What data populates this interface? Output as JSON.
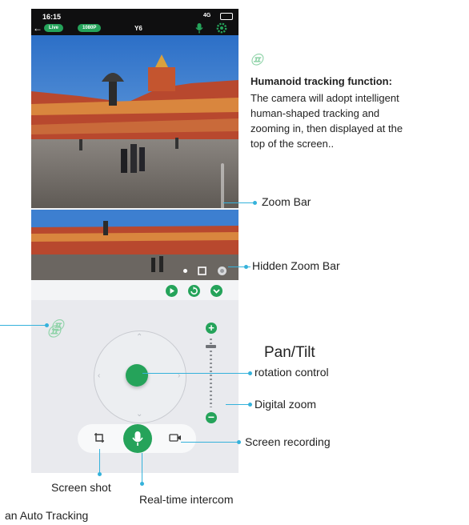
{
  "status_bar": {
    "time": "16:15",
    "signal": "4G"
  },
  "header": {
    "live_pill": "Live",
    "quality_pill": "1080P",
    "device_name": "Y6"
  },
  "control": {
    "track_icon_text": "㉬",
    "zoom_plus": "+",
    "zoom_minus": "−"
  },
  "annotations": {
    "humanoid_title": "Humanoid tracking function:",
    "humanoid_desc": "The camera will adopt intelligent\nhuman-shaped tracking and\nzooming in, then displayed at the\ntop of the screen..",
    "zoom_bar": "Zoom Bar",
    "hidden_zoom_bar": "Hidden Zoom Bar",
    "pan_tilt": "Pan/Tilt",
    "rotation_control": "rotation control",
    "digital_zoom": "Digital zoom",
    "screen_recording": "Screen recording",
    "screen_shot": "Screen shot",
    "real_time_intercom": "Real-time intercom",
    "auto_tracking": "an Auto Tracking",
    "sparkle_glyph": "㉬"
  },
  "colors": {
    "accent_green": "#25a35a",
    "callout_blue": "#35b2db"
  },
  "icons": [
    "back-arrow-icon",
    "mic-icon",
    "settings-gear-icon",
    "play-icon",
    "refresh-icon",
    "chevron-down-icon",
    "screenshot-icon",
    "record-icon",
    "fullscreen-icon",
    "square-icon",
    "dot-icon"
  ]
}
